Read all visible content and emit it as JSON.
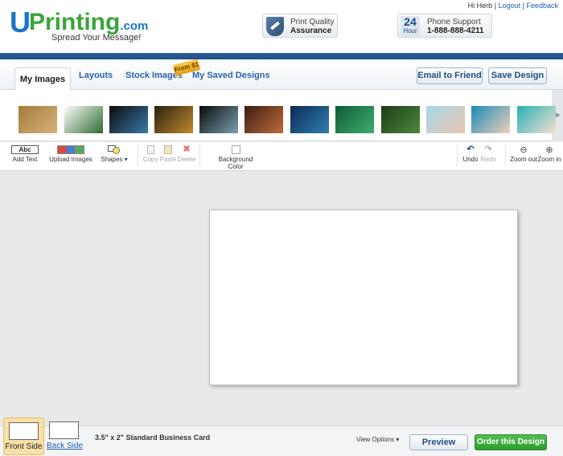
{
  "header": {
    "logo_u": "U",
    "logo_printing": "Printing",
    "logo_com": ".com",
    "tagline": "Spread Your Message!",
    "greeting": "Hi Herb",
    "logout": "Logout",
    "feedback": "Feedback",
    "separator": "|",
    "quality_line1": "Print Quality",
    "quality_line2": "Assurance",
    "hour_num": "24",
    "hour_label": "Hour",
    "support_line1": "Phone Support",
    "support_line2": "1-888-888-4211"
  },
  "tabs": {
    "my_images": "My Images",
    "layouts": "Layouts",
    "stock_images": "Stock Images",
    "stock_badge": "From $1",
    "saved_designs": "My Saved Designs"
  },
  "actions": {
    "email": "Email to Friend",
    "save": "Save Design"
  },
  "thumbnails": [
    {
      "name": "thumb-sepia-photo",
      "colors": [
        "#a57a3c",
        "#d4b27a"
      ]
    },
    {
      "name": "thumb-text-banner",
      "colors": [
        "#ffffff",
        "#2e6b2e"
      ]
    },
    {
      "name": "thumb-shark",
      "colors": [
        "#0b0b0b",
        "#3a7aa8"
      ]
    },
    {
      "name": "thumb-diver-poster",
      "colors": [
        "#2a2010",
        "#c08a2a"
      ]
    },
    {
      "name": "thumb-fish",
      "colors": [
        "#0a0a0a",
        "#7aa0b0"
      ]
    },
    {
      "name": "thumb-shell",
      "colors": [
        "#3a1e12",
        "#c06b3a"
      ]
    },
    {
      "name": "thumb-turtle",
      "colors": [
        "#0d2a55",
        "#2f7fb0"
      ]
    },
    {
      "name": "thumb-underwater-green",
      "colors": [
        "#0e5a3a",
        "#3fae6a"
      ]
    },
    {
      "name": "thumb-wreck",
      "colors": [
        "#1e3a1a",
        "#4a8a3a"
      ]
    },
    {
      "name": "thumb-jelly-pale",
      "colors": [
        "#a8d8e8",
        "#e8c4b0"
      ]
    },
    {
      "name": "thumb-jelly-blue",
      "colors": [
        "#1a8ab8",
        "#f0d0b8"
      ]
    },
    {
      "name": "thumb-jelly-teal",
      "colors": [
        "#2ab0b8",
        "#f4e0d0"
      ]
    }
  ],
  "toolbar": {
    "add_text": "Add Text",
    "add_text_icon": "Abc",
    "upload_images": "Upload Images",
    "shapes": "Shapes",
    "copy": "Copy",
    "paste": "Paste",
    "delete": "Delete",
    "background_color": "Background Color",
    "undo": "Undo",
    "redo": "Redo",
    "zoom_out": "Zoom out",
    "zoom_in": "Zoom in"
  },
  "bottom": {
    "front_side": "Front Side",
    "back_side": "Back Side",
    "card_size": "3.5\" x 2\" Standard Business Card",
    "view_options": "View Options",
    "preview": "Preview",
    "order": "Order this Design"
  },
  "colors": {
    "brand_blue": "#1976c7",
    "brand_green": "#3aa43a",
    "order_green": "#2f9a2f"
  }
}
